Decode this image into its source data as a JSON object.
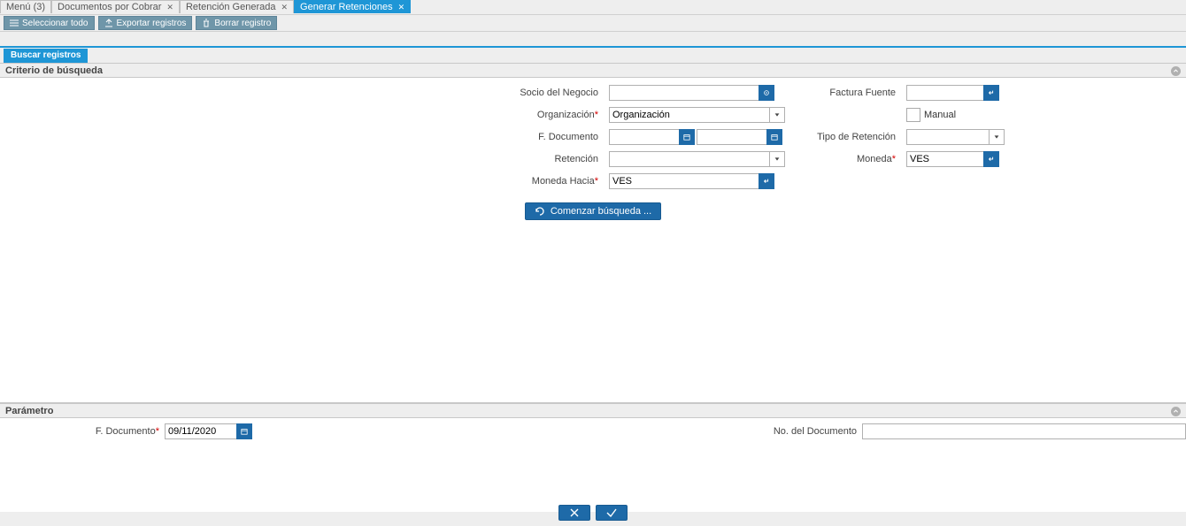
{
  "tabs": [
    {
      "label": "Menú (3)",
      "closable": false,
      "active": false
    },
    {
      "label": "Documentos por Cobrar",
      "closable": true,
      "active": false
    },
    {
      "label": "Retención Generada",
      "closable": true,
      "active": false
    },
    {
      "label": "Generar Retenciones",
      "closable": true,
      "active": true
    }
  ],
  "toolbar": {
    "select_all": "Seleccionar todo",
    "export": "Exportar registros",
    "delete": "Borrar registro"
  },
  "search_section_tab": "Buscar registros",
  "criteria_header": "Criterio de búsqueda",
  "labels": {
    "socio": "Socio del Negocio",
    "factura": "Factura Fuente",
    "org": "Organización",
    "manual": "Manual",
    "fdoc": "F. Documento",
    "tipo_ret": "Tipo de Retención",
    "retencion": "Retención",
    "moneda": "Moneda",
    "moneda_hacia": "Moneda Hacia"
  },
  "values": {
    "socio": "",
    "factura": "",
    "org_selected": "Organización",
    "manual_checked": false,
    "fdoc_from": "",
    "fdoc_to": "",
    "tipo_ret": "",
    "retencion": "",
    "moneda": "VES",
    "moneda_hacia": "VES"
  },
  "start_search_btn": "Comenzar búsqueda ...",
  "param_header": "Parámetro",
  "param": {
    "fdoc_label": "F. Documento",
    "fdoc_value": "09/11/2020",
    "docno_label": "No. del Documento",
    "docno_value": ""
  }
}
